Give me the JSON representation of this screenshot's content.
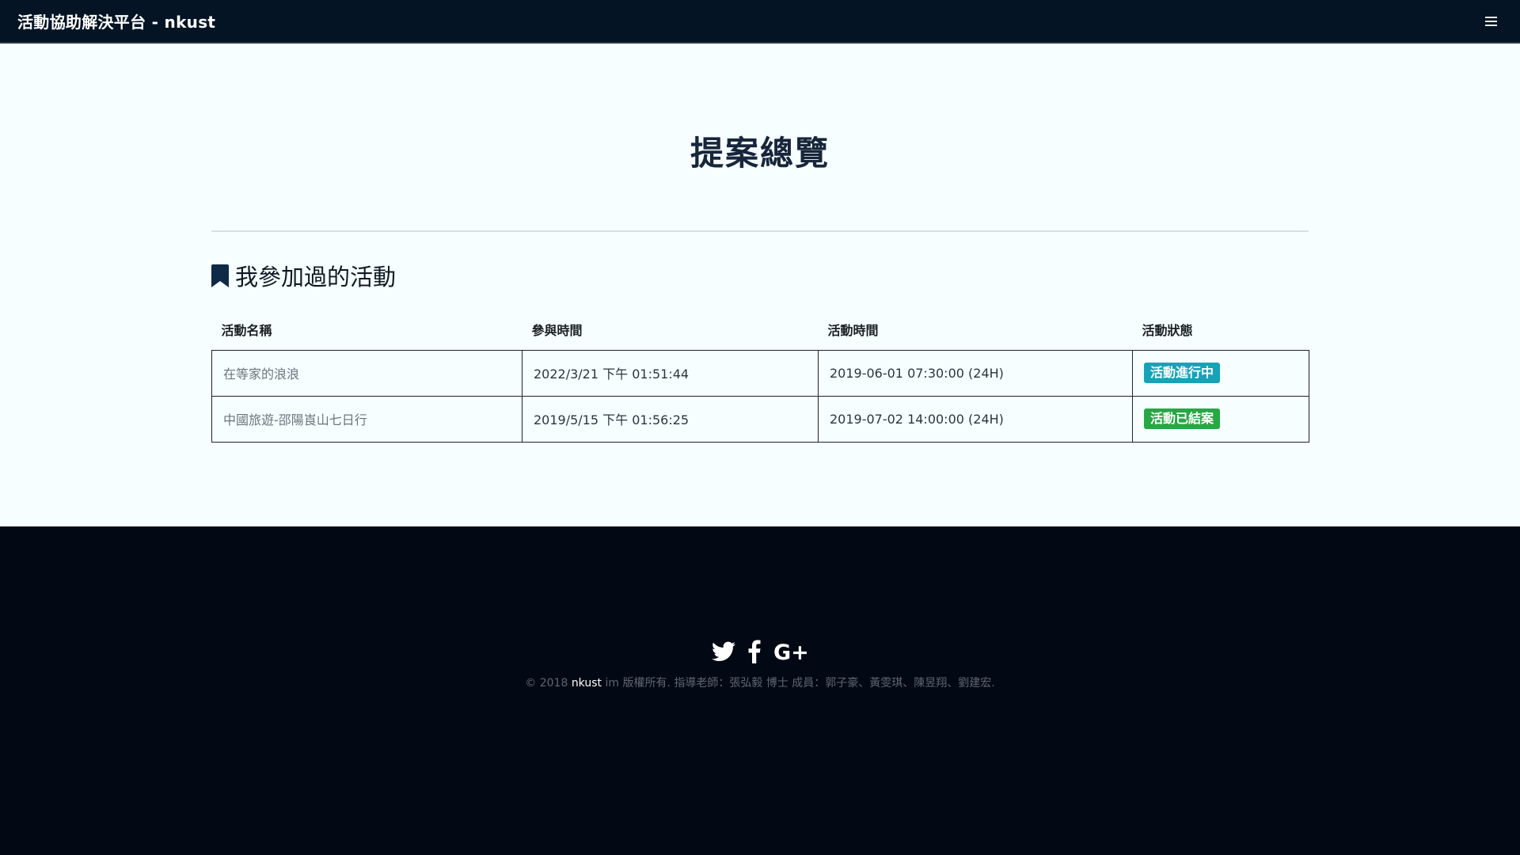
{
  "navbar": {
    "brand": "活動協助解決平台 - nkust",
    "menu_icon": "hamburger-menu-icon"
  },
  "page": {
    "title": "提案總覽"
  },
  "section": {
    "icon": "bookmark-icon",
    "heading": "我參加過的活動"
  },
  "table": {
    "headers": [
      "活動名稱",
      "參與時間",
      "活動時間",
      "活動狀態"
    ],
    "rows": [
      {
        "name": "在等家的浪浪",
        "join_time": "2022/3/21 下午 01:51:44",
        "event_time": "2019-06-01 07:30:00 (24H)",
        "status": "活動進行中",
        "status_color": "#17a2b8"
      },
      {
        "name": "中國旅遊-邵陽崀山七日行",
        "join_time": "2019/5/15 下午 01:56:25",
        "event_time": "2019-07-02 14:00:00 (24H)",
        "status": "活動已結案",
        "status_color": "#28a745"
      }
    ]
  },
  "footer": {
    "social_icons": [
      "twitter-icon",
      "facebook-icon",
      "google-plus-icon"
    ],
    "copyright_prefix": "© 2018 ",
    "copyright_org": "nkust",
    "copyright_suffix": " im 版權所有. 指導老師：張弘毅 博士 成員：郭子豪、黃雯琪、陳昱翔、劉建宏."
  },
  "colors": {
    "navbar_bg": "#041424",
    "main_bg": "#f6feff",
    "footer_bg": "#020914",
    "title_text": "#17263a"
  }
}
